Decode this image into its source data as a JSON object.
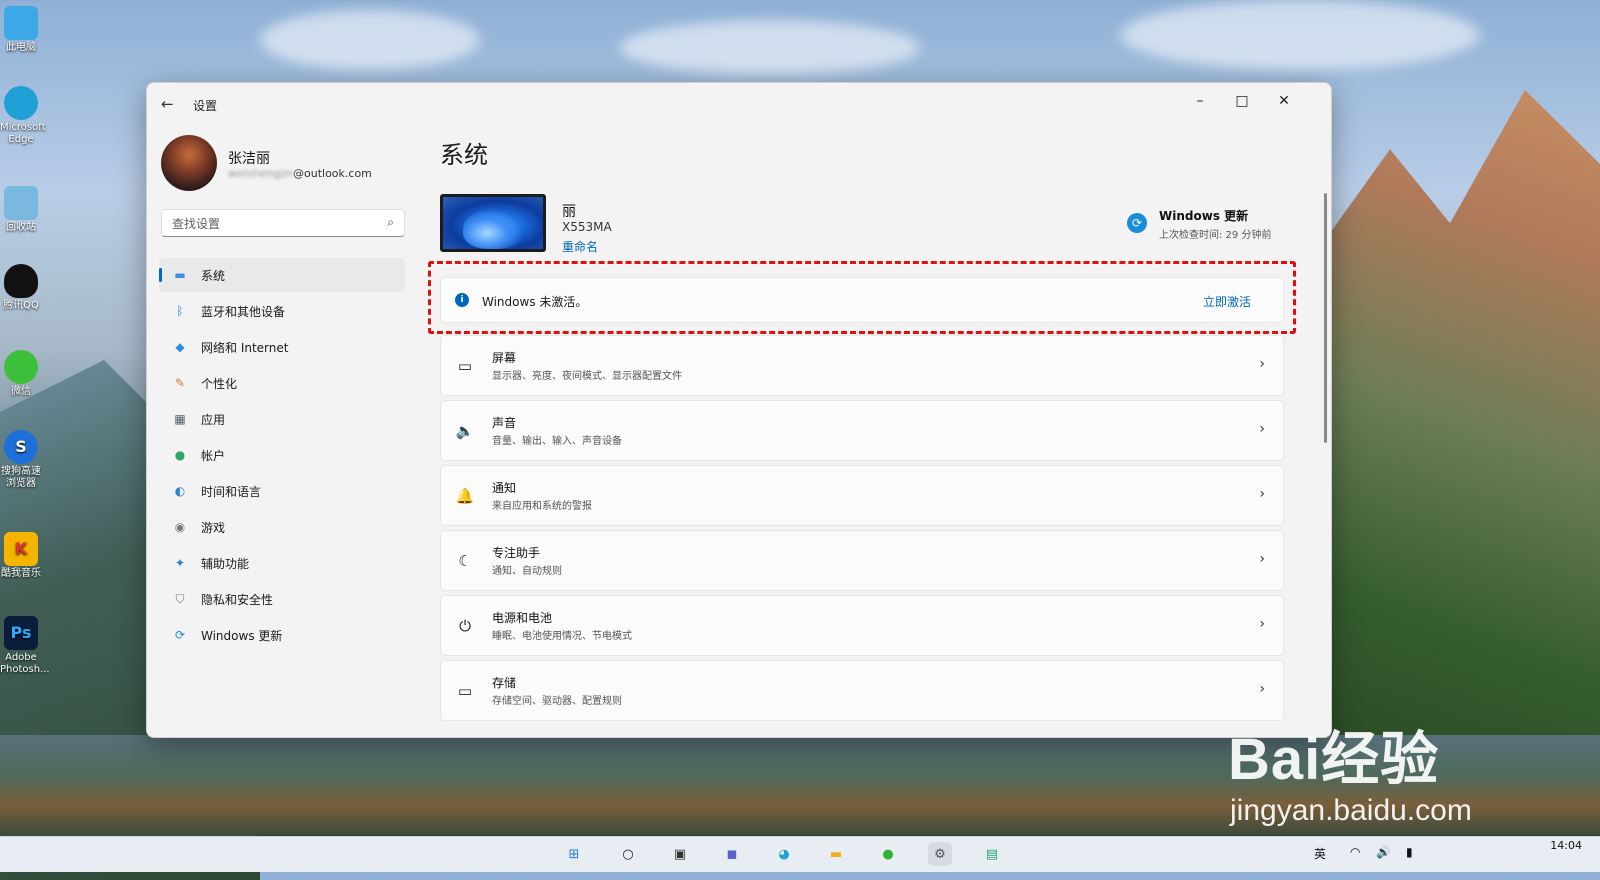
{
  "desktop": {
    "icons": [
      {
        "label": "此电脑",
        "icon": "computer-icon",
        "color": "#3da8e8"
      },
      {
        "label": "Microsoft Edge",
        "icon": "edge-icon",
        "color": "#1fa0d6"
      },
      {
        "label": "回收站",
        "icon": "recycle-bin-icon",
        "color": "#7ab8e0"
      },
      {
        "label": "腾讯QQ",
        "icon": "qq-icon",
        "color": "#111111"
      },
      {
        "label": "微信",
        "icon": "wechat-icon",
        "color": "#3cc03c"
      },
      {
        "label": "搜狗高速浏览器",
        "icon": "sogou-browser-icon",
        "color": "#1e6fd9"
      },
      {
        "label": "酷我音乐",
        "icon": "kuwo-music-icon",
        "color": "#f5b400"
      },
      {
        "label": "Adobe Photosh...",
        "icon": "photoshop-icon",
        "color": "#0b1d3a"
      }
    ]
  },
  "window": {
    "app_title": "设置",
    "back_glyph": "←",
    "controls": {
      "minimize": "–",
      "maximize": "□",
      "close": "✕"
    }
  },
  "profile": {
    "name": "张洁丽",
    "email_hidden": "weishengzn",
    "email_domain": "@outlook.com"
  },
  "search": {
    "placeholder": "查找设置",
    "icon_glyph": "⌕"
  },
  "nav": {
    "items": [
      {
        "label": "系统",
        "icon": "display-icon",
        "glyph": "▬",
        "color": "#3a8ee6",
        "active": true
      },
      {
        "label": "蓝牙和其他设备",
        "icon": "bluetooth-icon",
        "glyph": "ᛒ",
        "color": "#1a7fd6",
        "active": false
      },
      {
        "label": "网络和 Internet",
        "icon": "wifi-icon",
        "glyph": "◆",
        "color": "#2a8fe0",
        "active": false
      },
      {
        "label": "个性化",
        "icon": "brush-icon",
        "glyph": "✎",
        "color": "#d0743a",
        "active": false
      },
      {
        "label": "应用",
        "icon": "apps-icon",
        "glyph": "▦",
        "color": "#555e6b",
        "active": false
      },
      {
        "label": "帐户",
        "icon": "account-icon",
        "glyph": "●",
        "color": "#2fa56b",
        "active": false
      },
      {
        "label": "时间和语言",
        "icon": "globe-clock-icon",
        "glyph": "◐",
        "color": "#2b86d8",
        "active": false
      },
      {
        "label": "游戏",
        "icon": "gamepad-icon",
        "glyph": "◉",
        "color": "#777777",
        "active": false
      },
      {
        "label": "辅助功能",
        "icon": "accessibility-icon",
        "glyph": "✦",
        "color": "#1a7fd6",
        "active": false
      },
      {
        "label": "隐私和安全性",
        "icon": "shield-icon",
        "glyph": "⛉",
        "color": "#7a7a7a",
        "active": false
      },
      {
        "label": "Windows 更新",
        "icon": "update-icon",
        "glyph": "⟳",
        "color": "#1a8cdb",
        "active": false
      }
    ]
  },
  "main": {
    "title": "系统",
    "device": {
      "name": "丽",
      "model": "X553MA",
      "rename": "重命名"
    },
    "windows_update": {
      "title": "Windows 更新",
      "subtitle": "上次检查时间: 29 分钟前",
      "glyph": "⟳"
    },
    "activation": {
      "message": "Windows 未激活。",
      "action": "立即激活",
      "info_glyph": "i"
    },
    "settings": [
      {
        "title": "屏幕",
        "subtitle": "显示器、亮度、夜间模式、显示器配置文件",
        "icon": "monitor-icon",
        "glyph": "▭"
      },
      {
        "title": "声音",
        "subtitle": "音量、输出、输入、声音设备",
        "icon": "speaker-icon",
        "glyph": "🔈"
      },
      {
        "title": "通知",
        "subtitle": "来自应用和系统的警报",
        "icon": "bell-icon",
        "glyph": "🔔"
      },
      {
        "title": "专注助手",
        "subtitle": "通知、自动规则",
        "icon": "moon-icon",
        "glyph": "☾"
      },
      {
        "title": "电源和电池",
        "subtitle": "睡眠、电池使用情况、节电模式",
        "icon": "power-icon",
        "glyph": "⏻"
      },
      {
        "title": "存储",
        "subtitle": "存储空间、驱动器、配置规则",
        "icon": "storage-icon",
        "glyph": "▭"
      }
    ],
    "chevron": "›"
  },
  "taskbar": {
    "icons": [
      {
        "icon": "start-icon",
        "glyph": "⊞",
        "color": "#1a7fd6"
      },
      {
        "icon": "search-icon",
        "glyph": "○",
        "color": "#222222"
      },
      {
        "icon": "task-view-icon",
        "glyph": "▣",
        "color": "#333333"
      },
      {
        "icon": "teams-icon",
        "glyph": "◼",
        "color": "#5b5fc7"
      },
      {
        "icon": "edge-icon",
        "glyph": "◕",
        "color": "#1fa0d6"
      },
      {
        "icon": "file-explorer-icon",
        "glyph": "▬",
        "color": "#f2b01e"
      },
      {
        "icon": "wechat-icon",
        "glyph": "●",
        "color": "#2fb52f"
      },
      {
        "icon": "settings-gear-icon",
        "glyph": "⚙",
        "color": "#555555"
      },
      {
        "icon": "app-icon",
        "glyph": "▤",
        "color": "#2aa86b"
      }
    ],
    "tray": {
      "lang": "英",
      "wifi_glyph": "◠",
      "volume_glyph": "🔊",
      "battery_glyph": "▮"
    },
    "time": "14:04"
  },
  "watermark": {
    "brand": "Bai经验",
    "url": "jingyan.baidu.com"
  }
}
